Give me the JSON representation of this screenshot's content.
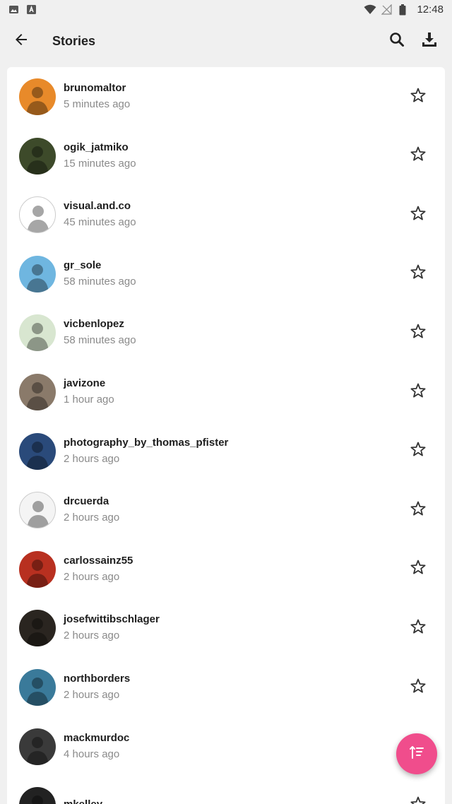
{
  "status_bar": {
    "time": "12:48",
    "left_icons": [
      "image-icon",
      "a-badge-icon"
    ],
    "right_icons": [
      "wifi-icon",
      "no-signal-icon",
      "battery-icon"
    ]
  },
  "app_bar": {
    "title": "Stories",
    "back_icon": "arrow-left-icon",
    "actions": [
      "search-icon",
      "download-icon"
    ]
  },
  "stories": [
    {
      "username": "brunomaltor",
      "time": "5 minutes ago",
      "avatar_color": "#e88a2a"
    },
    {
      "username": "ogik_jatmiko",
      "time": "15 minutes ago",
      "avatar_color": "#3d4a2a"
    },
    {
      "username": "visual.and.co",
      "time": "45 minutes ago",
      "avatar_color": "#ffffff"
    },
    {
      "username": "gr_sole",
      "time": "58 minutes ago",
      "avatar_color": "#6fb6e0"
    },
    {
      "username": "vicbenlopez",
      "time": "58 minutes ago",
      "avatar_color": "#d8e6d0"
    },
    {
      "username": "javizone",
      "time": "1 hour ago",
      "avatar_color": "#8a7a6a"
    },
    {
      "username": "photography_by_thomas_pfister",
      "time": "2 hours ago",
      "avatar_color": "#2a4a7a"
    },
    {
      "username": "drcuerda",
      "time": "2 hours ago",
      "avatar_color": "#f4f4f4"
    },
    {
      "username": "carlossainz55",
      "time": "2 hours ago",
      "avatar_color": "#b83020"
    },
    {
      "username": "josefwittibschlager",
      "time": "2 hours ago",
      "avatar_color": "#2a2520"
    },
    {
      "username": "northborders",
      "time": "2 hours ago",
      "avatar_color": "#3a7a9a"
    },
    {
      "username": "mackmurdoc",
      "time": "4 hours ago",
      "avatar_color": "#3a3a3a"
    },
    {
      "username": "mkelley",
      "time": "",
      "avatar_color": "#222222"
    }
  ],
  "star_icon": "star-outline-icon",
  "fab": {
    "icon": "sort-icon",
    "color": "#f04d8c"
  }
}
